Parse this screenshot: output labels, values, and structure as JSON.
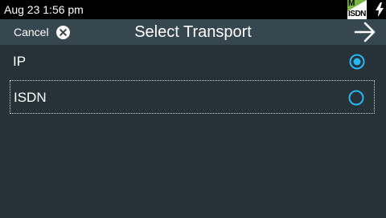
{
  "status_bar": {
    "time": "Aug 23 1:56 pm",
    "isdn_badge_letter": "M",
    "isdn_badge_label": "ISDN"
  },
  "header": {
    "cancel_label": "Cancel",
    "title": "Select Transport"
  },
  "options": [
    {
      "label": "IP",
      "selected": true
    },
    {
      "label": "ISDN",
      "selected": false
    }
  ],
  "colors": {
    "background": "#263238",
    "header": "#37474f",
    "accent": "#29b6f6",
    "badge_green": "#7cb342"
  }
}
